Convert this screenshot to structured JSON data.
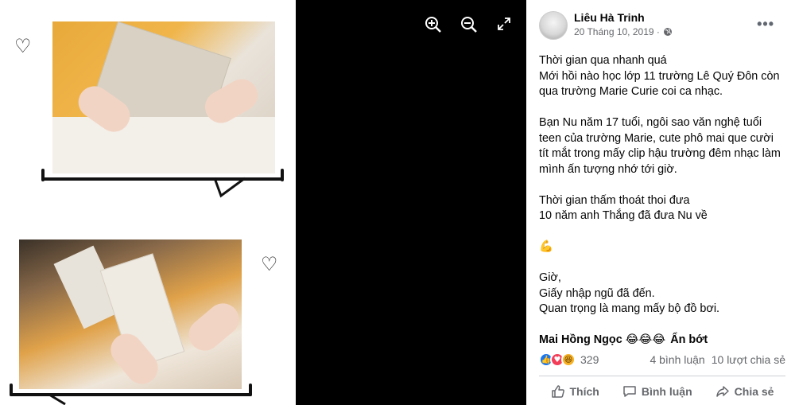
{
  "viewer": {
    "zoom_in_icon": "zoom-in-icon",
    "zoom_out_icon": "zoom-out-icon",
    "expand_icon": "expand-icon"
  },
  "post": {
    "author": "Liêu Hà Trinh",
    "date": "20 Tháng 10, 2019 ·",
    "privacy_icon": "globe-icon",
    "paragraphs": [
      [
        "Thời gian qua nhanh quá",
        "Mới hồi nào học lớp 11 trường Lê Quý Đôn còn qua trường Marie Curie coi ca nhạc."
      ],
      [
        "Bạn Nu năm 17 tuổi, ngôi sao văn nghệ tuổi teen của trường Marie, cute phô mai que cười tít mắt trong mấy clip hậu trường đêm nhạc làm mình ấn tượng nhớ tới giờ."
      ],
      [
        "Thời gian thấm thoát thoi đưa",
        "10 năm anh Thắng đã đưa Nu về"
      ],
      [
        "💪"
      ],
      [
        "Giờ,",
        "Giấy nhập ngũ đã đến.",
        "Quan trọng là mang mấy bộ đồ bơi."
      ]
    ],
    "mention": "Mai Hồng Ngọc",
    "mention_emojis": "😂😂😂",
    "see_less": "Ẩn bớt"
  },
  "stats": {
    "reaction_count": "329",
    "comments": "4 bình luận",
    "shares": "10 lượt chia sẻ"
  },
  "actions": {
    "like": "Thích",
    "comment": "Bình luận",
    "share": "Chia sẻ"
  }
}
